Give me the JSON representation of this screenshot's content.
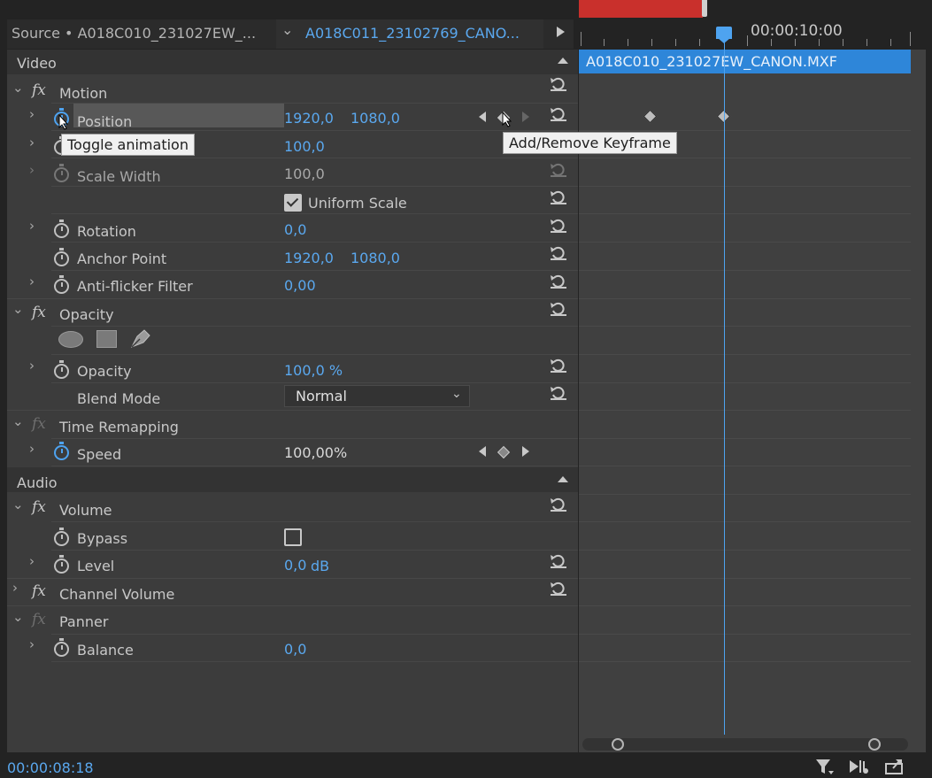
{
  "header": {
    "source_tab": "Source • A018C010_231027EW_...",
    "clip_tab": "A018C011_23102769_CANO...",
    "clip_chevron_icon": "chevron-down-icon",
    "play_icon": "play-icon"
  },
  "timeline": {
    "ruler_time": "00:00:10:00",
    "clip_name": "A018C010_231027EW_CANON.MXF"
  },
  "video": {
    "header": "Video",
    "motion": {
      "label": "Motion",
      "position": {
        "label": "Position",
        "x": "1920,0",
        "y": "1080,0"
      },
      "scale": {
        "value": "100,0"
      },
      "scale_width": {
        "label": "Scale Width",
        "value": "100,0"
      },
      "uniform_scale": {
        "label": "Uniform Scale",
        "checked": true
      },
      "rotation": {
        "label": "Rotation",
        "value": "0,0"
      },
      "anchor_point": {
        "label": "Anchor Point",
        "x": "1920,0",
        "y": "1080,0"
      },
      "anti_flicker": {
        "label": "Anti-flicker Filter",
        "value": "0,00"
      }
    },
    "opacity": {
      "label": "Opacity",
      "opacity_prop": {
        "label": "Opacity",
        "value": "100,0 %"
      },
      "blend_mode": {
        "label": "Blend Mode",
        "value": "Normal"
      }
    },
    "time_remapping": {
      "label": "Time Remapping",
      "speed": {
        "label": "Speed",
        "value": "100,00%"
      }
    }
  },
  "audio": {
    "header": "Audio",
    "volume": {
      "label": "Volume",
      "bypass": {
        "label": "Bypass",
        "checked": false
      },
      "level": {
        "label": "Level",
        "value": "0,0",
        "unit": "dB"
      }
    },
    "channel_volume": {
      "label": "Channel Volume"
    },
    "panner": {
      "label": "Panner",
      "balance": {
        "label": "Balance",
        "value": "0,0"
      }
    }
  },
  "tooltips": {
    "toggle_animation": "Toggle animation",
    "add_remove_keyframe": "Add/Remove Keyframe"
  },
  "footer": {
    "timecode": "00:00:08:18",
    "filter_icon": "filter-icon",
    "play_audio_icon": "play-audio-icon",
    "export_icon": "export-icon"
  },
  "colors": {
    "accent_blue": "#4ea3f0",
    "value_blue": "#5aa8ef",
    "clip_bar": "#2e86d9",
    "work_area_red": "#c9302c",
    "panel_bg": "#3c3c3c"
  }
}
